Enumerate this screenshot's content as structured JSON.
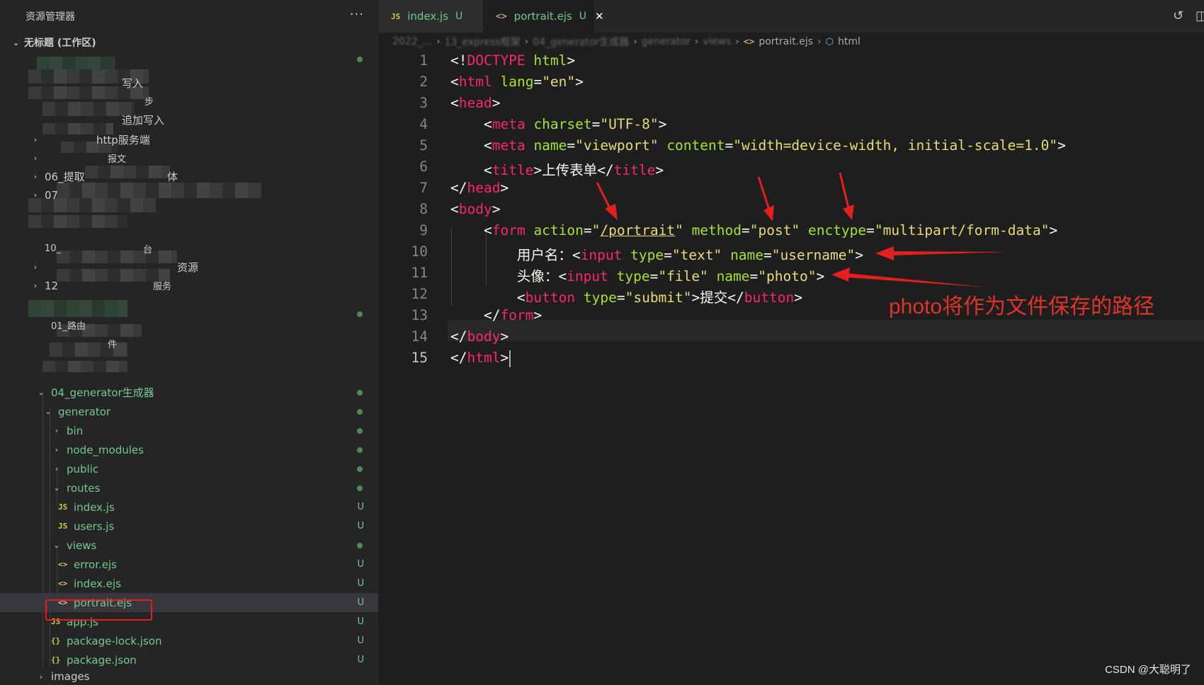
{
  "explorer": {
    "title": "资源管理器",
    "more": "···",
    "workspace": "无标题 (工作区)",
    "visible_labels": {
      "r1": "写入",
      "r2": "步",
      "r3": "追加写入",
      "r4": "http服务端",
      "r5": "报文",
      "r6a": "06_提取",
      "r6b": "体",
      "r7": "07",
      "r9": "10_",
      "r9b": "台",
      "r10": "资源",
      "r11a": "12",
      "r11b": "服务",
      "r13": "01_路由",
      "r14": "件"
    },
    "tree": [
      {
        "label": "04_generator生成器",
        "status": "dot"
      },
      {
        "label": "generator",
        "status": "dot"
      },
      {
        "label": "bin",
        "status": "dot"
      },
      {
        "label": "node_modules",
        "status": "dot"
      },
      {
        "label": "public",
        "status": "dot"
      },
      {
        "label": "routes",
        "status": "dot"
      },
      {
        "label": "index.js",
        "status": "U"
      },
      {
        "label": "users.js",
        "status": "U"
      },
      {
        "label": "views",
        "status": "dot"
      },
      {
        "label": "error.ejs",
        "status": "U"
      },
      {
        "label": "index.ejs",
        "status": "U"
      },
      {
        "label": "portrait.ejs",
        "status": "U"
      },
      {
        "label": "app.js",
        "status": "U"
      },
      {
        "label": "package-lock.json",
        "status": "U"
      },
      {
        "label": "package.json",
        "status": "U"
      },
      {
        "label": "images",
        "status": ""
      }
    ]
  },
  "tabs": [
    {
      "icon": "JS",
      "label": "index.js",
      "status": "U"
    },
    {
      "icon": "<>",
      "label": "portrait.ejs",
      "status": "U",
      "close": "✕"
    }
  ],
  "breadcrumb": {
    "blurred": [
      "2022_...",
      "13_express框架",
      "04_generator生成器",
      "generator",
      "views"
    ],
    "file": "portrait.ejs",
    "symbol": "html"
  },
  "code": {
    "line_numbers": [
      "1",
      "2",
      "3",
      "4",
      "5",
      "6",
      "7",
      "8",
      "9",
      "10",
      "11",
      "12",
      "13",
      "14",
      "15"
    ],
    "current_line": 15,
    "tokens": {
      "doctype": "DOCTYPE",
      "html_kw": "html",
      "lang": "lang",
      "en": "\"en\"",
      "head": "head",
      "meta": "meta",
      "charset": "charset",
      "utf8": "\"UTF-8\"",
      "name": "name",
      "viewport": "\"viewport\"",
      "content": "content",
      "content_val": "\"width=device-width, initial-scale=1.0\"",
      "title": "title",
      "title_text": "上传表单",
      "body": "body",
      "form": "form",
      "action": "action",
      "action_val": "/portrait",
      "method": "method",
      "method_val": "\"post\"",
      "enctype": "enctype",
      "enctype_val": "\"multipart/form-data\"",
      "username_label": "用户名：",
      "input": "input",
      "type": "type",
      "text_val": "\"text\"",
      "username_val": "\"username\"",
      "avatar_label": "头像：",
      "file_val": "\"file\"",
      "photo_val": "\"photo\"",
      "button": "button",
      "submit_val": "\"submit\"",
      "submit_text": "提交"
    }
  },
  "annotation": "photo将作为文件保存的路径",
  "watermark": "CSDN @大聪明了",
  "colors": {
    "tag": "#f92672",
    "attr": "#a6e22e",
    "string": "#e6db74",
    "untracked": "#73c991",
    "arrow": "#e51f1f"
  }
}
